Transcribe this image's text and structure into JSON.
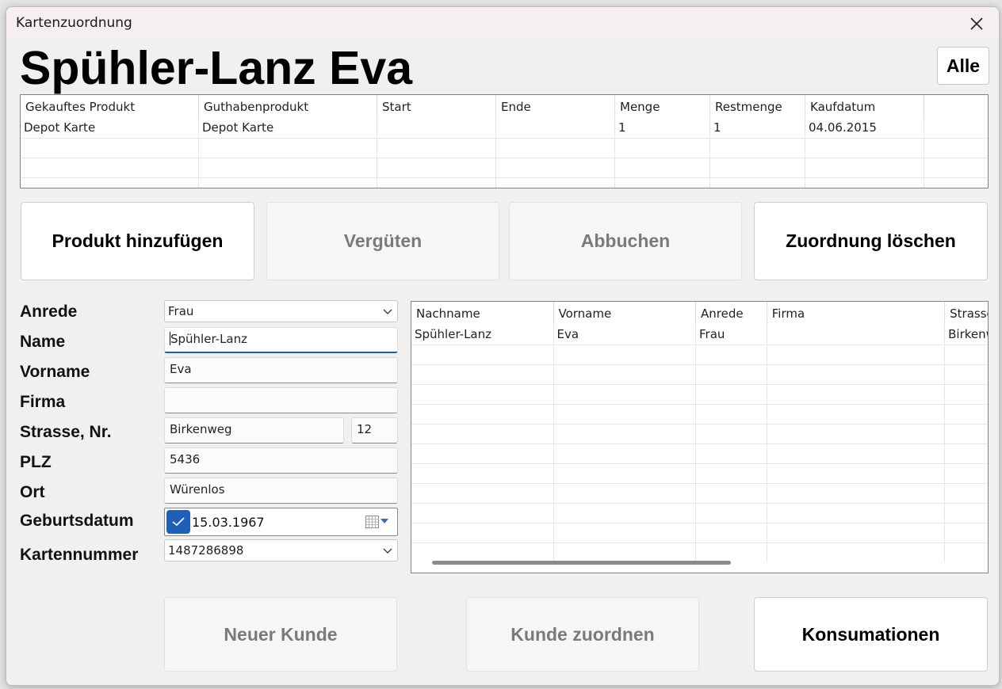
{
  "window": {
    "title": "Kartenzuordnung"
  },
  "customer_title": "Spühler-Lanz Eva",
  "buttons": {
    "alle": "Alle",
    "produkt_hinzufuegen": "Produkt hinzufügen",
    "verguten": "Vergüten",
    "abbuchen": "Abbuchen",
    "zuordnung_loeschen": "Zuordnung löschen",
    "neuer_kunde": "Neuer Kunde",
    "kunde_zuordnen": "Kunde zuordnen",
    "konsumationen": "Konsumationen"
  },
  "products_grid": {
    "columns": [
      "Gekauftes Produkt",
      "Guthabenprodukt",
      "Start",
      "Ende",
      "Menge",
      "Restmenge",
      "Kaufdatum",
      ""
    ],
    "rows": [
      [
        "Depot Karte",
        "Depot Karte",
        "",
        "",
        "1",
        "1",
        "04.06.2015",
        ""
      ]
    ]
  },
  "form": {
    "labels": {
      "anrede": "Anrede",
      "name": "Name",
      "vorname": "Vorname",
      "firma": "Firma",
      "strasse": "Strasse, Nr.",
      "plz": "PLZ",
      "ort": "Ort",
      "geburtsdatum": "Geburtsdatum",
      "kartennummer": "Kartennummer"
    },
    "values": {
      "anrede": "Frau",
      "name": "Spühler-Lanz",
      "vorname": "Eva",
      "firma": "",
      "strasse": "Birkenweg",
      "nr": "12",
      "plz": "5436",
      "ort": "Würenlos",
      "geburtsdatum": "15.03.1967",
      "kartennummer": "1487286898"
    }
  },
  "customers_grid": {
    "columns": [
      "Nachname",
      "Vorname",
      "Anrede",
      "Firma",
      "Strasse"
    ],
    "rows": [
      [
        "Spühler-Lanz",
        "Eva",
        "Frau",
        "",
        "Birkenweg"
      ]
    ]
  },
  "colors": {
    "accent": "#1f5fb8",
    "focus": "#1f5f9e",
    "disabled_text": "#7a7a7a"
  }
}
